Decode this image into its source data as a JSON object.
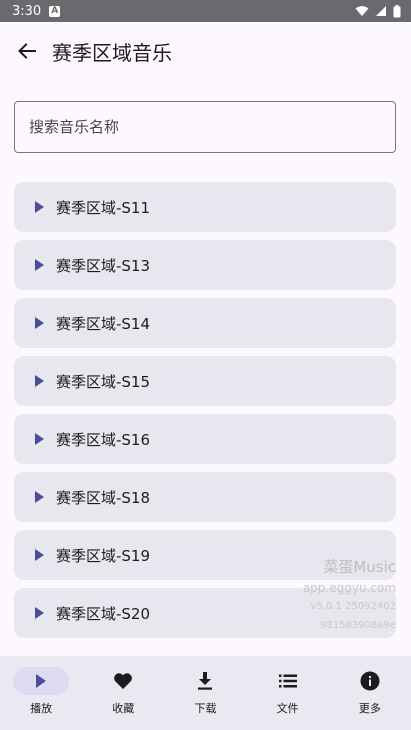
{
  "status_bar": {
    "time": "3:30",
    "notification_icon": "A"
  },
  "app_bar": {
    "title": "赛季区域音乐"
  },
  "search": {
    "placeholder": "搜索音乐名称",
    "value": ""
  },
  "list": {
    "items": [
      {
        "label": "赛季区域-S11"
      },
      {
        "label": "赛季区域-S13"
      },
      {
        "label": "赛季区域-S14"
      },
      {
        "label": "赛季区域-S15"
      },
      {
        "label": "赛季区域-S16"
      },
      {
        "label": "赛季区域-S18"
      },
      {
        "label": "赛季区域-S19"
      },
      {
        "label": "赛季区域-S20"
      }
    ]
  },
  "watermark": {
    "app_name": "菜蛋Music",
    "site": "app.eggyu.com",
    "version": "v5.0.1 25092402",
    "build": "981583908a9e"
  },
  "bottom_nav": {
    "items": [
      {
        "label": "播放",
        "icon": "play-icon",
        "active": true
      },
      {
        "label": "收藏",
        "icon": "heart-icon",
        "active": false
      },
      {
        "label": "下载",
        "icon": "download-icon",
        "active": false
      },
      {
        "label": "文件",
        "icon": "list-icon",
        "active": false
      },
      {
        "label": "更多",
        "icon": "info-icon",
        "active": false
      }
    ]
  },
  "colors": {
    "accent": "#4a4e9a",
    "list_item_bg": "#e8e7ef",
    "background": "#fcf8fd",
    "status_bar": "#6a6a6e",
    "nav_active_pill": "#dcdbf2"
  }
}
